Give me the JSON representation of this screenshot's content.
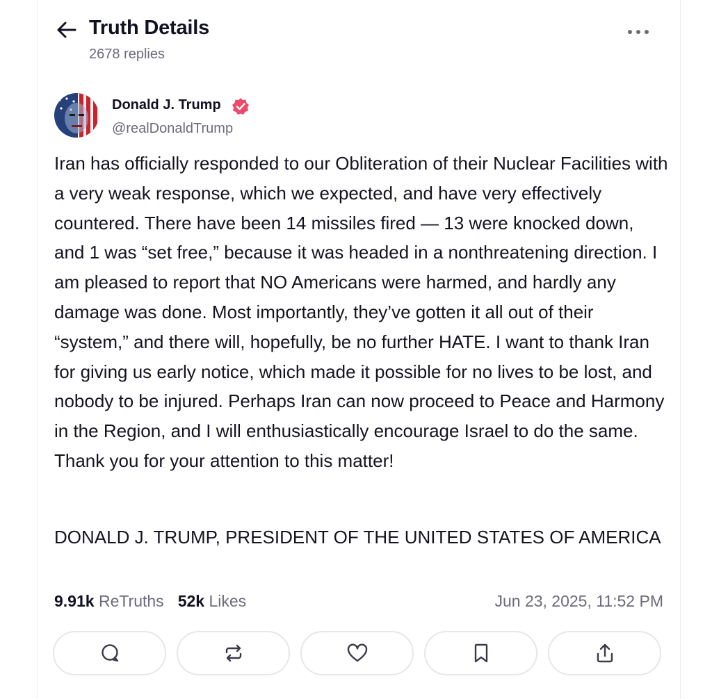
{
  "header": {
    "title": "Truth Details",
    "replies": "2678 replies",
    "back_icon": "arrow-left-icon",
    "more_icon": "more-horizontal-icon"
  },
  "post": {
    "author": {
      "name": "Donald J. Trump",
      "handle": "@realDonaldTrump",
      "verified": true,
      "verified_color": "#ef4a6b"
    },
    "text": "Iran has officially responded to our Obliteration of their Nuclear Facilities with a very weak response, which we expected, and have very effectively countered. There have been 14 missiles fired — 13 were knocked down, and 1 was “set free,” because it was headed in a nonthreatening direction. I am pleased to report that NO Americans were harmed, and hardly any damage was done. Most importantly, they’ve gotten it all out of their “system,” and there will, hopefully, be no further HATE. I want to thank Iran for giving us early notice, which made it possible for no lives to be lost, and nobody to be injured. Perhaps Iran can now proceed to Peace and Harmony in the Region, and I will enthusiastically encourage Israel to do the same. Thank you for your attention to this matter!",
    "signature": "DONALD J. TRUMP, PRESIDENT OF THE UNITED STATES OF AMERICA",
    "stats": {
      "retruths_count": "9.91k",
      "retruths_label": "ReTruths",
      "likes_count": "52k",
      "likes_label": "Likes"
    },
    "timestamp": "Jun 23, 2025, 11:52 PM"
  },
  "actions": [
    {
      "name": "reply",
      "icon": "comment-icon"
    },
    {
      "name": "retruth",
      "icon": "repost-icon"
    },
    {
      "name": "like",
      "icon": "heart-icon"
    },
    {
      "name": "bookmark",
      "icon": "bookmark-icon"
    },
    {
      "name": "share",
      "icon": "share-icon"
    }
  ],
  "colors": {
    "text": "#111122",
    "muted": "#6b6b7b",
    "border": "#e6e6ec"
  }
}
